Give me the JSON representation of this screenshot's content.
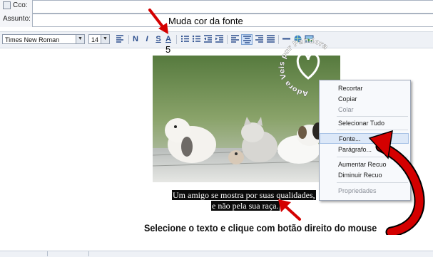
{
  "header": {
    "cco_label": "Cco:",
    "assunto_label": "Assunto:"
  },
  "toolbar": {
    "font_name": "Times New Roman",
    "font_size": "14",
    "buttons": [
      "N",
      "I",
      "S",
      "A"
    ]
  },
  "annotations": {
    "font_color_note": "Muda cor da fonte",
    "step_number": "5",
    "instruction": "Selecione o texto e clique com botão direito do mouse"
  },
  "watermark": {
    "text": "Adora Veis por Pandora"
  },
  "caption": {
    "line1": "Um amigo se mostra por suas qualidades,",
    "line2": "e não pela sua raça."
  },
  "context_menu": {
    "items": [
      {
        "label": "Recortar",
        "enabled": true
      },
      {
        "label": "Copiar",
        "enabled": true
      },
      {
        "label": "Colar",
        "enabled": false
      },
      {
        "label": "Selecionar Tudo",
        "enabled": true
      },
      {
        "label": "Fonte...",
        "enabled": true
      },
      {
        "label": "Parágrafo...",
        "enabled": true
      },
      {
        "label": "Aumentar Recuo",
        "enabled": true
      },
      {
        "label": "Diminuir Recuo",
        "enabled": true
      },
      {
        "label": "Propriedades",
        "enabled": false
      }
    ],
    "highlighted": "Fonte..."
  },
  "colors": {
    "red_arrow": "#d40000",
    "toolbar_bg": "#eef1f6",
    "menu_highlight": "#dce8f8"
  }
}
